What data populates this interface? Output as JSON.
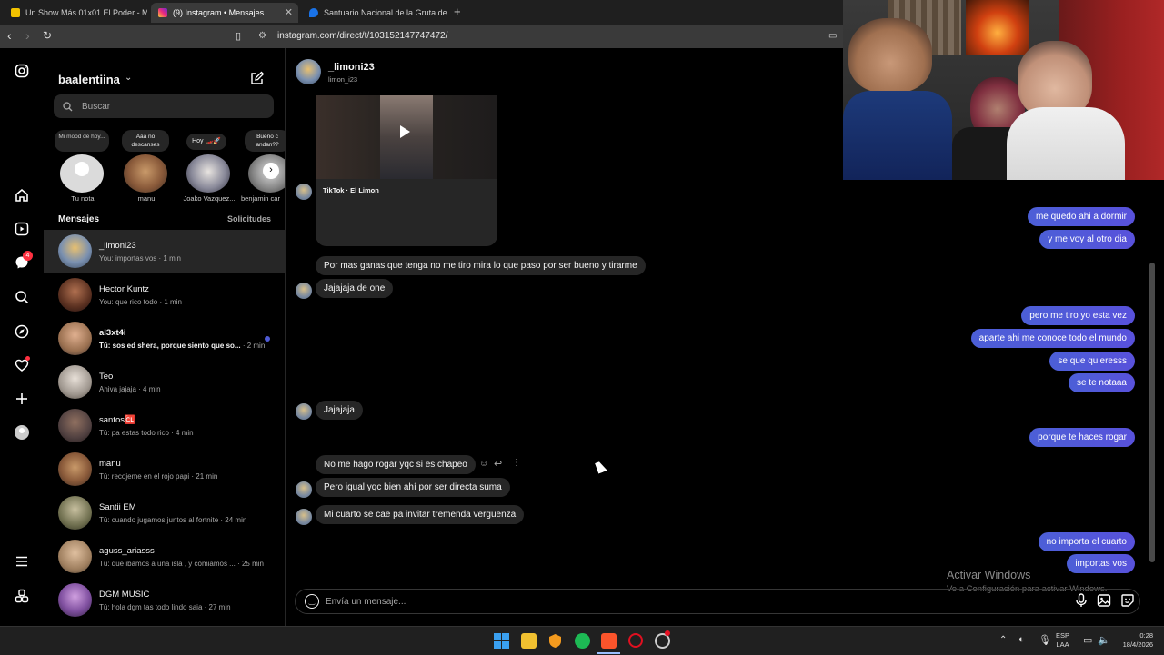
{
  "browser": {
    "tabs": [
      {
        "label": "Un Show Más 01x01 El Poder - Mis C",
        "active": false
      },
      {
        "label": "(9) Instagram • Mensajes",
        "active": true
      },
      {
        "label": "Santuario Nacional de la Gruta de Lo",
        "active": false
      }
    ],
    "new_tab": "+",
    "url": "instagram.com/direct/t/103152147747472/"
  },
  "inbox": {
    "username": "baalentiina",
    "search_placeholder": "Buscar",
    "notes": [
      {
        "bubble": "Mi mood de hoy...",
        "name": "Tu nota"
      },
      {
        "bubble": "Aaa no descanses",
        "name": "manu"
      },
      {
        "bubble": "Hoy 🏎️🚀",
        "name": "Joako Vazquez..."
      },
      {
        "bubble": "Bueno c andan??",
        "name": "benjamin car"
      }
    ],
    "messages_heading": "Mensajes",
    "requests_label": "Solicitudes",
    "conversations": [
      {
        "name": "_limoni23",
        "preview": "You: importas vos",
        "time": "· 1 min"
      },
      {
        "name": "Hector Kuntz",
        "preview": "You: que rico todo",
        "time": "· 1 min"
      },
      {
        "name": "al3xt4i",
        "preview": "Tú: sos ed shera, porque siento que so...",
        "time": "· 2 min"
      },
      {
        "name": "Teo",
        "preview": "Ahiva jajaja",
        "time": "· 4 min"
      },
      {
        "name": "santos🆑",
        "preview": "Tú: pa estas todo rico",
        "time": "· 4 min"
      },
      {
        "name": "manu",
        "preview": "Tú: recojeme en el rojo papi",
        "time": "· 21 min"
      },
      {
        "name": "Santii EM",
        "preview": "Tú: cuando jugamos juntos al fortnite",
        "time": "· 24 min"
      },
      {
        "name": "aguss_ariasss",
        "preview": "Tú: que ibamos a una isla , y comiamos ...",
        "time": "· 25 min"
      },
      {
        "name": "DGM MUSIC",
        "preview": "Tú: hola dgm tas todo lindo saia",
        "time": "· 27 min"
      }
    ]
  },
  "chat": {
    "contact_name": "_limoni23",
    "contact_handle": "limon_i23",
    "shared_post_caption": "TikTok · El Limon",
    "incoming": [
      "Por mas ganas que tenga no me tiro mira lo que paso por ser bueno y tirarme",
      "Jajajaja de one",
      "Jajajaja",
      "No me hago rogar yqc si es chapeo",
      "Pero igual yqc bien ahí por ser directa suma",
      "Mi cuarto  se cae pa invitar tremenda vergüenza"
    ],
    "outgoing": [
      "me quedo ahi a dormir",
      "y me voy al otro dia",
      "pero me tiro yo esta vez",
      "aparte ahi me conoce todo el mundo",
      "se que quieresss",
      "se te notaaa",
      "porque te haces rogar",
      "no importa el cuarto",
      "importas vos"
    ],
    "composer_placeholder": "Envía un mensaje...",
    "watermark_title": "Activar Windows",
    "watermark_sub": "Ve a Configuración para activar Windows."
  },
  "taskbar": {
    "lang_top": "ESP",
    "lang_bottom": "LAA",
    "time": "0:28",
    "date": "18/4/2026"
  },
  "colors": {
    "outgoing_bubble": "#4f5bd5",
    "incoming_bubble": "#262626",
    "background": "#000000",
    "notification": "#ff3040"
  }
}
